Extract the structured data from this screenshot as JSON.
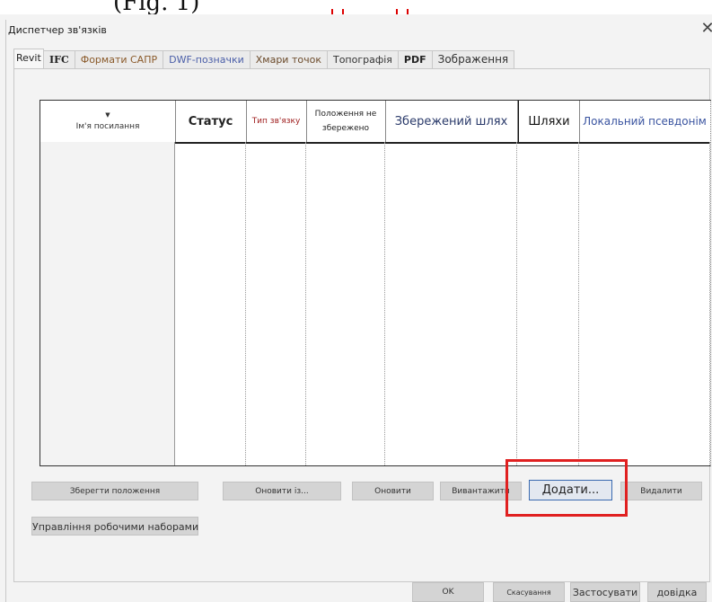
{
  "window": {
    "title": "Диспетчер зв'язків",
    "close_glyph": "✕"
  },
  "top_fragment": {
    "text": "(Fig. 1)"
  },
  "tabs": [
    {
      "label": "Revit",
      "active": true
    },
    {
      "label": "IFC",
      "active": false
    },
    {
      "label": "Формати САПР",
      "active": false
    },
    {
      "label": "DWF-позначки",
      "active": false
    },
    {
      "label": "Хмари точок",
      "active": false
    },
    {
      "label": "Топографія",
      "active": false
    },
    {
      "label": "PDF",
      "active": false
    },
    {
      "label": "Зображення",
      "active": false
    }
  ],
  "table": {
    "sort_icon": "▼",
    "columns": [
      "Ім'я посилання",
      "Статус",
      "Тип зв'язку",
      "Положення не збережено",
      "Збережений шлях",
      "Шляхи",
      "Локальний псевдонім"
    ],
    "rows": []
  },
  "actions": {
    "save_positions": "Зберегти положення",
    "reload_from": "Оновити із...",
    "reload": "Оновити",
    "unload": "Вивантажити",
    "add": "Додати...",
    "remove": "Видалити",
    "manage_worksets": "Управління робочими наборами"
  },
  "footer": {
    "ok": "OK",
    "cancel": "Скасування",
    "apply": "Застосувати",
    "help": "довідка"
  },
  "colors": {
    "highlight": "#e02020",
    "dialog_bg": "#f3f3f3",
    "button_bg": "#d4d4d4"
  }
}
